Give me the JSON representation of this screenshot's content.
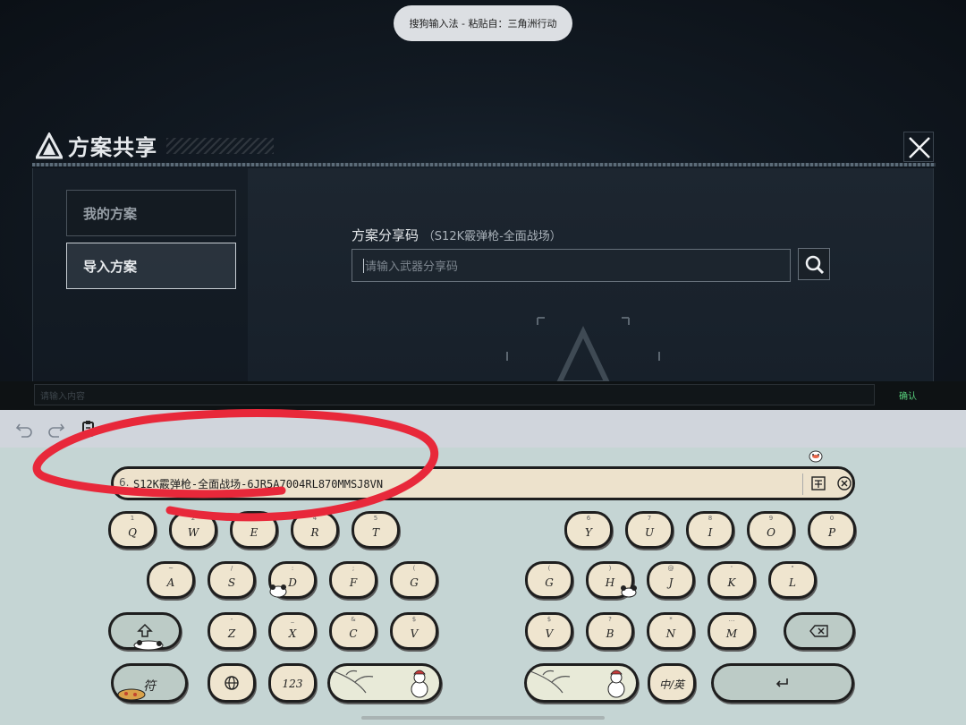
{
  "toast": {
    "text": "搜狗输入法 - 粘贴自：三角洲行动"
  },
  "panel": {
    "title": "方案共享",
    "tabs": [
      {
        "label": "我的方案"
      },
      {
        "label": "导入方案"
      }
    ],
    "share": {
      "label": "方案分享码",
      "weapon": "（S12K霰弹枪-全面战场）",
      "placeholder": "请输入武器分享码"
    }
  },
  "input_bar": {
    "placeholder": "请输入内容",
    "confirm_label": "确认"
  },
  "candidate": {
    "index": "6.",
    "text": "S12K霰弹枪-全面战场-6JR5A7004RL870MMSJ8VN"
  },
  "keys": {
    "row1_left": [
      {
        "hint": "1",
        "label": "Q"
      },
      {
        "hint": "2",
        "label": "W"
      },
      {
        "hint": "3",
        "label": "E"
      },
      {
        "hint": "4",
        "label": "R"
      },
      {
        "hint": "5",
        "label": "T"
      }
    ],
    "row1_right": [
      {
        "hint": "6",
        "label": "Y"
      },
      {
        "hint": "7",
        "label": "U"
      },
      {
        "hint": "8",
        "label": "I"
      },
      {
        "hint": "9",
        "label": "O"
      },
      {
        "hint": "0",
        "label": "P"
      }
    ],
    "row2_left": [
      {
        "hint": "~",
        "label": "A"
      },
      {
        "hint": "/",
        "label": "S"
      },
      {
        "hint": ":",
        "label": "D"
      },
      {
        "hint": ";",
        "label": "F"
      },
      {
        "hint": "(",
        "label": "G"
      }
    ],
    "row2_right": [
      {
        "hint": "(",
        "label": "G"
      },
      {
        "hint": ")",
        "label": "H"
      },
      {
        "hint": "@",
        "label": "J"
      },
      {
        "hint": "'",
        "label": "K"
      },
      {
        "hint": "\"",
        "label": "L"
      }
    ],
    "row3_left": [
      {
        "hint": "-",
        "label": "Z"
      },
      {
        "hint": "_",
        "label": "X"
      },
      {
        "hint": "&",
        "label": "C"
      },
      {
        "hint": "$",
        "label": "V"
      }
    ],
    "row3_right": [
      {
        "hint": "$",
        "label": "V"
      },
      {
        "hint": "?",
        "label": "B"
      },
      {
        "hint": "*",
        "label": "N"
      },
      {
        "hint": "…",
        "label": "M"
      }
    ],
    "symbol_label": "符",
    "num_label": "123",
    "lang_label": "中/英"
  },
  "colors": {
    "accent_green": "#58d07c",
    "key_face": "#efe5cf",
    "keyboard_bg": "#c5d5d4",
    "annotation_red": "#e8283a"
  }
}
